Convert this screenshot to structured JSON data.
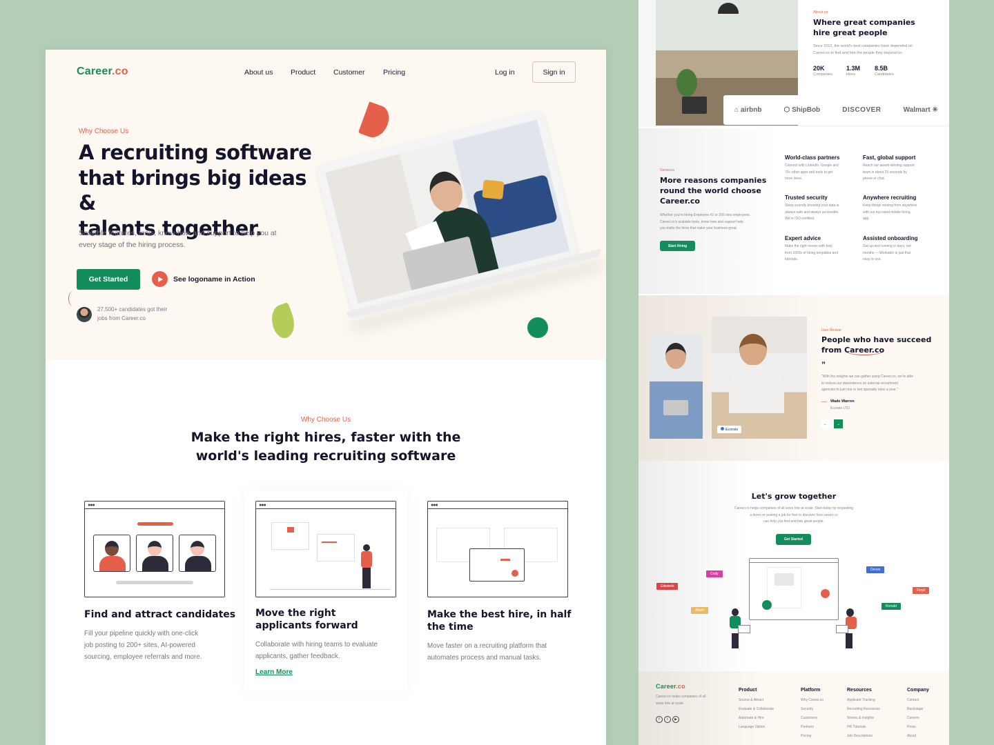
{
  "brand": {
    "name_main": "Career",
    "name_suffix": ".co",
    "primary_color": "#138d5c",
    "accent_color": "#e5604a",
    "backdrop_color": "#b3cdb6"
  },
  "nav": {
    "links": [
      "About us",
      "Product",
      "Customer",
      "Pricing"
    ],
    "login": "Log in",
    "signin": "Sign in"
  },
  "hero": {
    "eyebrow": "Why Choose Us",
    "title_lines": [
      "A recruiting software",
      "that brings big ideas &",
      "talents together."
    ],
    "subtitle_lines": [
      "Scalable features, tools, know-how and support to help you at",
      "every stage of the hiring process."
    ],
    "cta_primary": "Get Started",
    "cta_secondary": "See logoname in Action",
    "social_proof_lines": [
      "27,500+ candidates got their",
      "jobs from Career.co"
    ]
  },
  "why": {
    "eyebrow": "Why Choose Us",
    "title_lines": [
      "Make the right hires, faster with the",
      "world's leading recruiting software"
    ],
    "cards": [
      {
        "title_lines": [
          "Find and attract candidates"
        ],
        "desc_lines": [
          "Fill your pipeline quickly with one-click",
          "job posting to 200+ sites, AI-powered",
          "sourcing, employee referrals and more."
        ]
      },
      {
        "title_lines": [
          "Move the right",
          "applicants forward"
        ],
        "desc_lines": [
          "Collaborate with hiring teams to evaluate",
          "applicants, gather feedback."
        ],
        "link": "Learn More"
      },
      {
        "title_lines": [
          "Make the best hire, in half",
          "the time"
        ],
        "desc_lines": [
          "Move faster on a recruiting platform that",
          "automates process and manual tasks."
        ]
      }
    ]
  },
  "about": {
    "eyebrow": "About us",
    "title_lines": [
      "Where great companies",
      "hire great people"
    ],
    "desc_lines": [
      "Since 2012, the world's best companies have depended on",
      "Career.co to find and hire the people they depend on."
    ],
    "stats": [
      {
        "value": "20K",
        "label": "Companies"
      },
      {
        "value": "1.3M",
        "label": "Hires"
      },
      {
        "value": "8.5B",
        "label": "Candidates"
      }
    ],
    "logos": [
      "airbnb",
      "ShipBob",
      "DISCOVER",
      "Walmart"
    ]
  },
  "services": {
    "eyebrow": "Services",
    "title_lines": [
      "More reasons companies",
      "round the world choose",
      "Career.co"
    ],
    "desc_lines": [
      "Whether you're hiring Employee #2 or 200 new employees,",
      "Career.co's scalable tools, know-how and support help",
      "you make the hires that make your business great."
    ],
    "cta": "Start Hiring",
    "features": [
      {
        "title": "World-class partners",
        "desc_lines": [
          "Connect with LinkedIn, Google and",
          "70+ other apps and tools to get",
          "more done."
        ]
      },
      {
        "title": "Fast, global support",
        "desc_lines": [
          "Reach our award-winning support",
          "team in about 25 seconds by",
          "phone or chat."
        ]
      },
      {
        "title": "Trusted security",
        "desc_lines": [
          "Sleep soundly knowing your data is",
          "always safe and always accessible.",
          "We're ISO-certified."
        ]
      },
      {
        "title": "Anywhere recruiting",
        "desc_lines": [
          "Keep things moving from anywhere",
          "with our top-rated mobile hiring",
          "app."
        ]
      },
      {
        "title": "Expert advice",
        "desc_lines": [
          "Make the right moves with help",
          "from 1000s of hiring templates and",
          "tutorials."
        ]
      },
      {
        "title": "Assisted onboarding",
        "desc_lines": [
          "Get up and running in days, not",
          "months — Workable is just that",
          "easy to use."
        ]
      }
    ]
  },
  "review": {
    "eyebrow": "User Review",
    "title_line1": "People who have succeed",
    "title_line2_prefix": "from ",
    "title_line2_highlight": "Career.co",
    "quote_mark": "”",
    "quote_lines": [
      "\"With the insights we can gather using Career.co, we're able",
      "to reduce our dependence on external recruitment",
      "agencies to just one or two specialty roles a year.\""
    ],
    "author": "Wade Warren",
    "company": "Ecorate LTD.",
    "badge": "Ecorate",
    "prev": "←",
    "next": "→"
  },
  "grow": {
    "title": "Let's grow together",
    "desc_lines": [
      "Career.co helps companies of all sizes hire at scale. Start today by requesting",
      "a demo or posting a job for free to discover how career.co",
      "can help you find and hire great people."
    ],
    "cta": "Get Started",
    "tags": [
      {
        "name": "Edwards",
        "color": "#d94545"
      },
      {
        "name": "Cody",
        "color": "#d63fa6"
      },
      {
        "name": "Albert",
        "color": "#e8bb6a"
      },
      {
        "name": "Devon",
        "color": "#3f6fd6"
      },
      {
        "name": "Floyd",
        "color": "#e5604a"
      },
      {
        "name": "Ronald",
        "color": "#138d5c"
      }
    ]
  },
  "footer": {
    "blurb_lines": [
      "Career.co helps companies of all",
      "sizes hire at scale."
    ],
    "social": [
      "f",
      "t",
      "▶"
    ],
    "columns": [
      {
        "title": "Product",
        "items": [
          "Source & Attract",
          "Evaluate & Collaborate",
          "Automate & Hire",
          "Language Option"
        ]
      },
      {
        "title": "Platform",
        "items": [
          "Why Career.co",
          "Security",
          "Customers",
          "Partners",
          "Pricing"
        ]
      },
      {
        "title": "Resources",
        "items": [
          "Applicant Tracking",
          "Recruiting Resources",
          "Stories & Insights",
          "HR Tutorials",
          "Job Descriptions"
        ]
      },
      {
        "title": "Company",
        "items": [
          "Contact",
          "Backstage",
          "Careers",
          "Press",
          "About"
        ]
      }
    ]
  }
}
